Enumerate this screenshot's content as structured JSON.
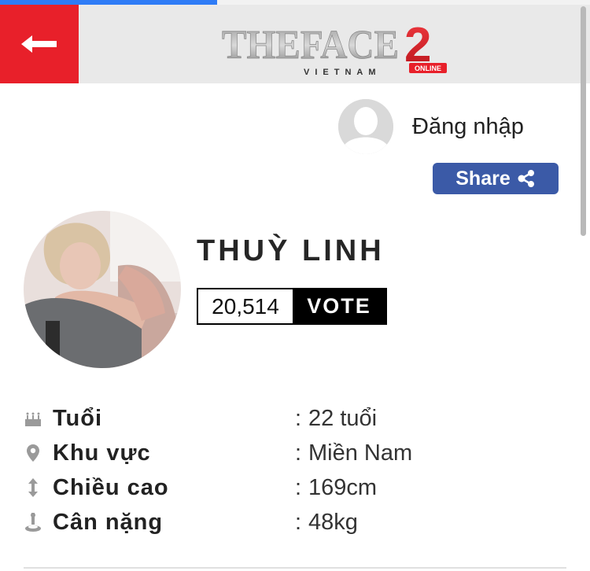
{
  "header": {
    "logo": {
      "text": "THEFACE",
      "number": "2",
      "country": "VIETNAM",
      "badge": "ONLINE"
    },
    "back_icon": "arrow-left-icon",
    "accent_color": "#e8202a"
  },
  "page_load_progress": 0.37,
  "account": {
    "login_label": "Đăng nhập",
    "avatar_icon": "user-silhouette-icon"
  },
  "share": {
    "label": "Share",
    "icon": "share-nodes-icon",
    "color": "#3b5aa7"
  },
  "contestant": {
    "name": "THUỲ LINH",
    "vote_count": "20,514",
    "vote_label": "VOTE"
  },
  "details": [
    {
      "icon": "cake-icon",
      "label": "Tuổi",
      "separator": ":",
      "value": "22 tuổi"
    },
    {
      "icon": "location-pin-icon",
      "label": "Khu vực",
      "separator": ":",
      "value": "Miền Nam"
    },
    {
      "icon": "height-arrow-icon",
      "label": "Chiều cao",
      "separator": ":",
      "value": "169cm"
    },
    {
      "icon": "weight-icon",
      "label": "Cân nặng",
      "separator": ":",
      "value": "48kg"
    }
  ]
}
